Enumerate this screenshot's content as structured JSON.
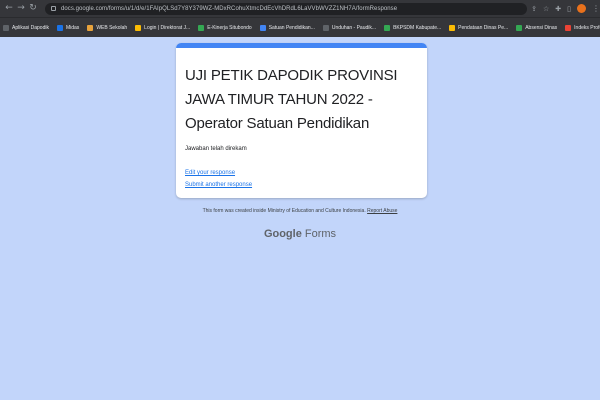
{
  "browser": {
    "url": "docs.google.com/forms/u/1/d/e/1FAIpQLSd7Y8Y379WZ-MDxRCohuXtmcDdEcVhDRdL6LaVVbWVZZ1NH7A/formResponse",
    "nav_back_icon": "arrow-left-icon",
    "nav_forward_icon": "arrow-right-icon",
    "reload_icon": "reload-icon"
  },
  "bookmarks": [
    {
      "label": "Aplikasi Dapodik",
      "color": "#5f6368"
    },
    {
      "label": "Midas",
      "color": "#1a73e8"
    },
    {
      "label": "WEB Sekolah",
      "color": "#e8a33c"
    },
    {
      "label": "Login | Direktorat J...",
      "color": "#fbbc04"
    },
    {
      "label": "E-Kinerja Situbondo",
      "color": "#34a853"
    },
    {
      "label": "Satuan Pendidikan...",
      "color": "#4285f4"
    },
    {
      "label": "Unduhan - Paudik...",
      "color": "#5f6368"
    },
    {
      "label": "BKPSDM Kabupate...",
      "color": "#34a853"
    },
    {
      "label": "Pendataan Dinas Pe...",
      "color": "#fbbc04"
    },
    {
      "label": "Absensi Dinas",
      "color": "#34a853"
    },
    {
      "label": "Indeks Profesionalit...",
      "color": "#ea4335"
    }
  ],
  "form": {
    "accent_color": "#4285f4",
    "title": "UJI PETIK DAPODIK PROVINSI JAWA TIMUR TAHUN 2022 - Operator Satuan Pendidikan",
    "confirmation": "Jawaban telah direkam",
    "edit_link": "Edit your response",
    "submit_another_link": "Submit another response"
  },
  "footer": {
    "notice": "This form was created inside Ministry of Education and Culture Indonesia.",
    "report": "Report Abuse",
    "brand_google": "Google",
    "brand_forms": "Forms"
  }
}
